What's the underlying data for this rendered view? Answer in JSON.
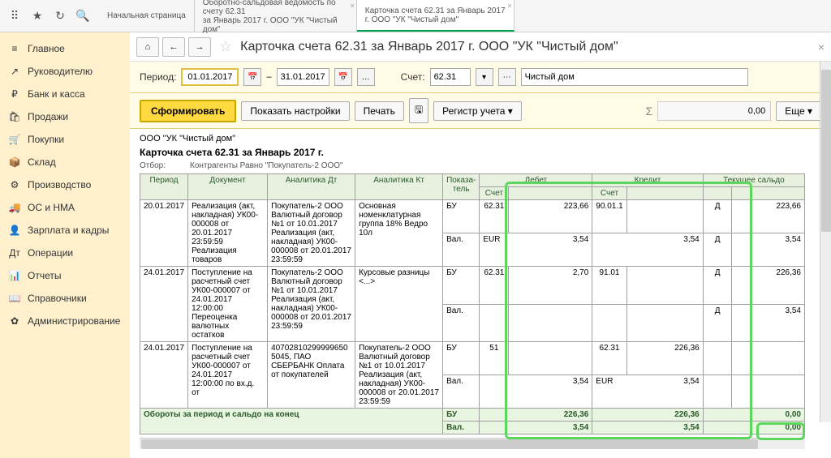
{
  "topbar": {
    "icons": [
      "apps",
      "star",
      "clock",
      "search"
    ]
  },
  "tabs": [
    {
      "label": "Начальная страница"
    },
    {
      "label": "Оборотно-сальдовая ведомость по счету 62.31",
      "sub": "за Январь 2017 г. ООО \"УК \"Чистый дом\""
    },
    {
      "label": "Карточка счета 62.31 за Январь 2017",
      "sub": "г. ООО \"УК \"Чистый дом\"",
      "active": true
    }
  ],
  "sidebar": [
    {
      "icon": "≡",
      "label": "Главное"
    },
    {
      "icon": "↗",
      "label": "Руководителю"
    },
    {
      "icon": "₽",
      "label": "Банк и касса"
    },
    {
      "icon": "🛍",
      "label": "Продажи"
    },
    {
      "icon": "🛒",
      "label": "Покупки"
    },
    {
      "icon": "📦",
      "label": "Склад"
    },
    {
      "icon": "⚙",
      "label": "Производство"
    },
    {
      "icon": "🚚",
      "label": "ОС и НМА"
    },
    {
      "icon": "👤",
      "label": "Зарплата и кадры"
    },
    {
      "icon": "Дт",
      "label": "Операции"
    },
    {
      "icon": "📊",
      "label": "Отчеты"
    },
    {
      "icon": "📖",
      "label": "Справочники"
    },
    {
      "icon": "✿",
      "label": "Администрирование"
    }
  ],
  "page_title": "Карточка счета 62.31 за Январь 2017 г. ООО \"УК \"Чистый дом\"",
  "params": {
    "period_label": "Период:",
    "from": "01.01.2017",
    "to": "31.01.2017",
    "dash": "–",
    "account_label": "Счет:",
    "account": "62.31",
    "org": "Чистый дом"
  },
  "toolbar": {
    "form": "Сформировать",
    "settings": "Показать настройки",
    "print": "Печать",
    "register": "Регистр учета",
    "sum": "0,00",
    "more": "Еще"
  },
  "report": {
    "org": "ООО \"УК \"Чистый дом\"",
    "title": "Карточка счета 62.31 за Январь 2017 г.",
    "filter_label": "Отбор:",
    "filter_value": "Контрагенты Равно \"Покупатель-2 ООО\"",
    "headers": {
      "period": "Период",
      "doc": "Документ",
      "an_dt": "Аналитика Дт",
      "an_kt": "Аналитика Кт",
      "ind": "Показа-\nтель",
      "debit": "Дебет",
      "credit": "Кредит",
      "balance": "Текущее сальдо",
      "acc": "Счет"
    },
    "rows": [
      {
        "date": "20.01.2017",
        "doc": "Реализация (акт, накладная) УК00-000008 от 20.01.2017 23:59:59 Реализация товаров",
        "dt": "Покупатель-2 ООО Валютный договор №1 от 10.01.2017 Реализация (акт, накладная) УК00-000008 от 20.01.2017 23:59:59",
        "kt": "Основная номенклатурная группа 18% Ведро 10л",
        "lines": [
          {
            "ind": "БУ",
            "dacc": "62.31",
            "dval": "223,66",
            "cacc": "90.01.1",
            "cval": "",
            "bdk": "Д",
            "bal": "223,66"
          },
          {
            "ind": "Вал.",
            "dacc": "",
            "dval": "EUR",
            "cacc": "",
            "cval": "3,54",
            "bdk": "Д",
            "bal": "3,54",
            "eur": true
          }
        ]
      },
      {
        "date": "24.01.2017",
        "doc": "Поступление на расчетный счет УК00-000007 от 24.01.2017 12:00:00 Переоценка валютных остатков",
        "dt": "Покупатель-2 ООО Валютный договор №1 от 10.01.2017 Реализация (акт, накладная) УК00-000008 от 20.01.2017 23:59:59",
        "kt": "Курсовые разницы <...>",
        "lines": [
          {
            "ind": "БУ",
            "dacc": "62.31",
            "dval": "2,70",
            "cacc": "91.01",
            "cval": "",
            "bdk": "Д",
            "bal": "226,36"
          },
          {
            "ind": "Вал.",
            "dacc": "",
            "dval": "",
            "cacc": "",
            "cval": "",
            "bdk": "Д",
            "bal": "3,54"
          }
        ]
      },
      {
        "date": "24.01.2017",
        "doc": "Поступление на расчетный счет УК00-000007 от 24.01.2017 12:00:00 по вх.д.  от",
        "dt": "40702810299999650 5045, ПАО СБЕРБАНК Оплата от покупателей",
        "kt": "Покупатель-2 ООО Валютный договор №1 от 10.01.2017 Реализация (акт, накладная) УК00-000008 от 20.01.2017 23:59:59",
        "lines": [
          {
            "ind": "БУ",
            "dacc": "51",
            "dval": "",
            "cacc": "62.31",
            "cval": "226,36",
            "bdk": "",
            "bal": ""
          },
          {
            "ind": "Вал.",
            "dacc": "",
            "dval": "",
            "cacc": "EUR",
            "cval": "3,54",
            "bdk": "",
            "bal": "",
            "eur": true
          }
        ]
      }
    ],
    "totals": {
      "label": "Обороты за период и сальдо на конец",
      "bu": "БУ",
      "val": "Вал.",
      "d1": "226,36",
      "d2": "3,54",
      "c1": "226,36",
      "c2": "3,54",
      "b1": "0,00",
      "b2": "0,00"
    }
  }
}
